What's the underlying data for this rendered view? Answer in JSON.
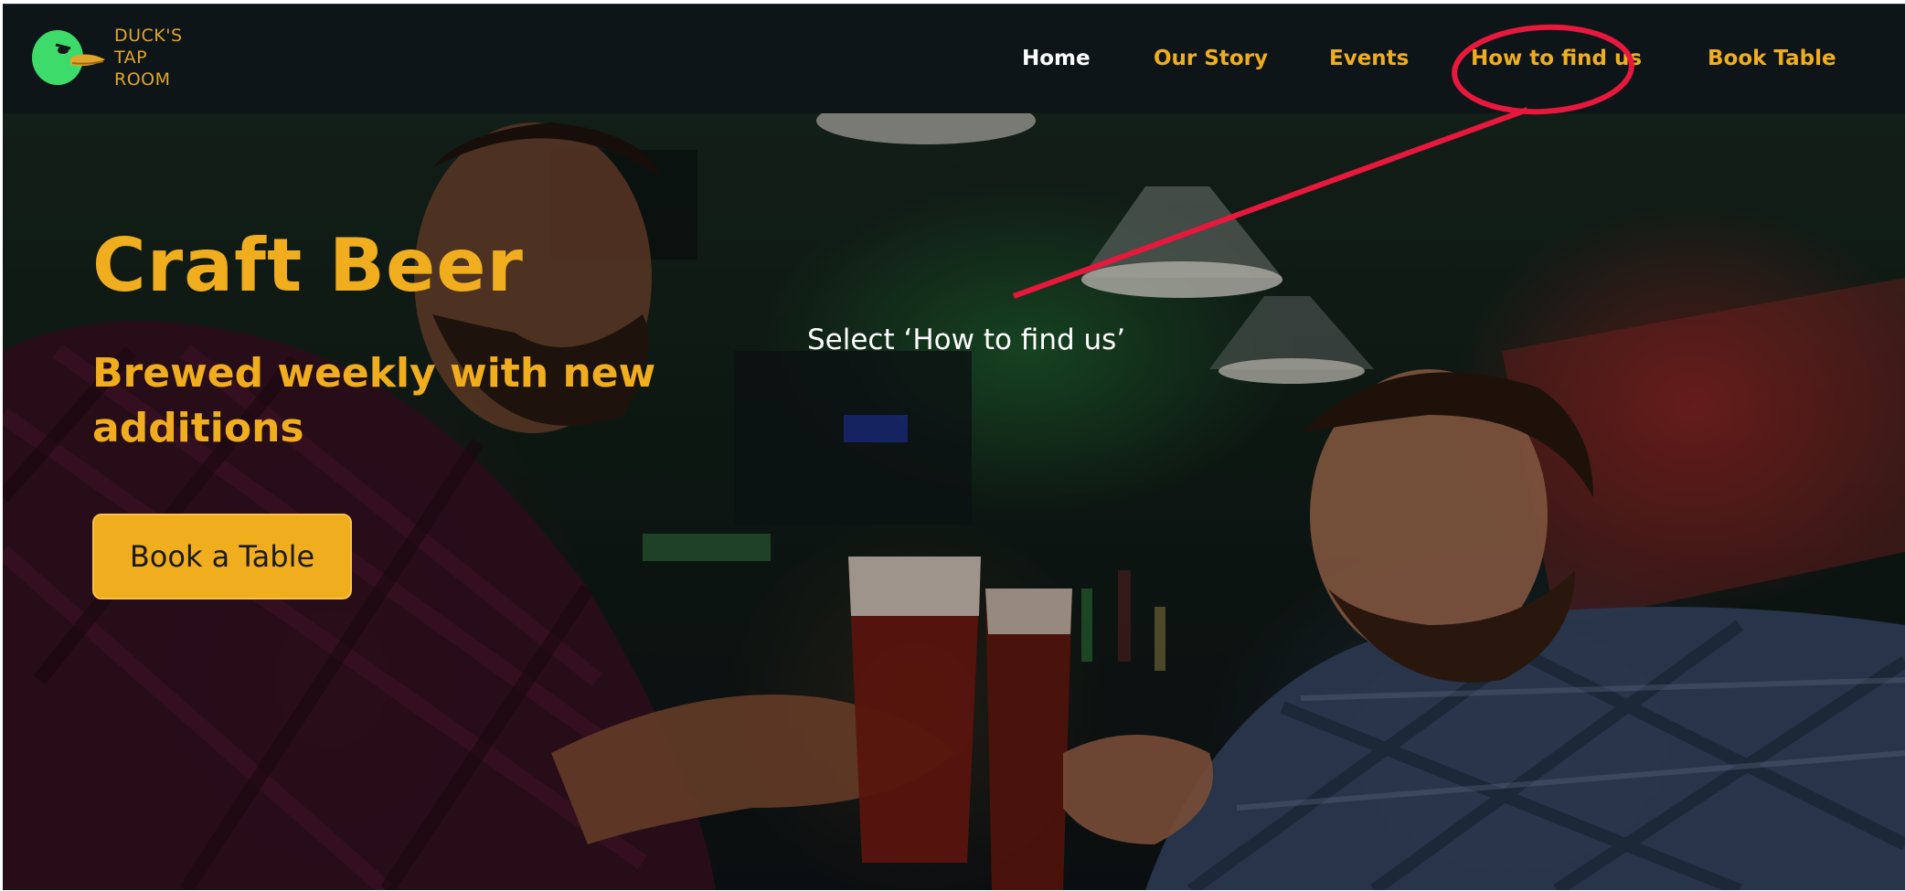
{
  "logo": {
    "line1": "DUCK'S",
    "line2": "TAP",
    "line3": "ROOM"
  },
  "nav": {
    "items": [
      {
        "label": "Home",
        "active": true
      },
      {
        "label": "Our Story",
        "active": false
      },
      {
        "label": "Events",
        "active": false
      },
      {
        "label": "How to find us",
        "active": false
      },
      {
        "label": "Book Table",
        "active": false
      }
    ]
  },
  "hero": {
    "title": "Craft Beer",
    "subtitle": "Brewed weekly with new additions",
    "cta_label": "Book a Table"
  },
  "annotation": {
    "text": "Select ‘How to find us’",
    "color": "#e8173c"
  },
  "colors": {
    "accent": "#f0ad1e",
    "nav_background": "#0e1519",
    "active_nav": "#ffffff"
  }
}
